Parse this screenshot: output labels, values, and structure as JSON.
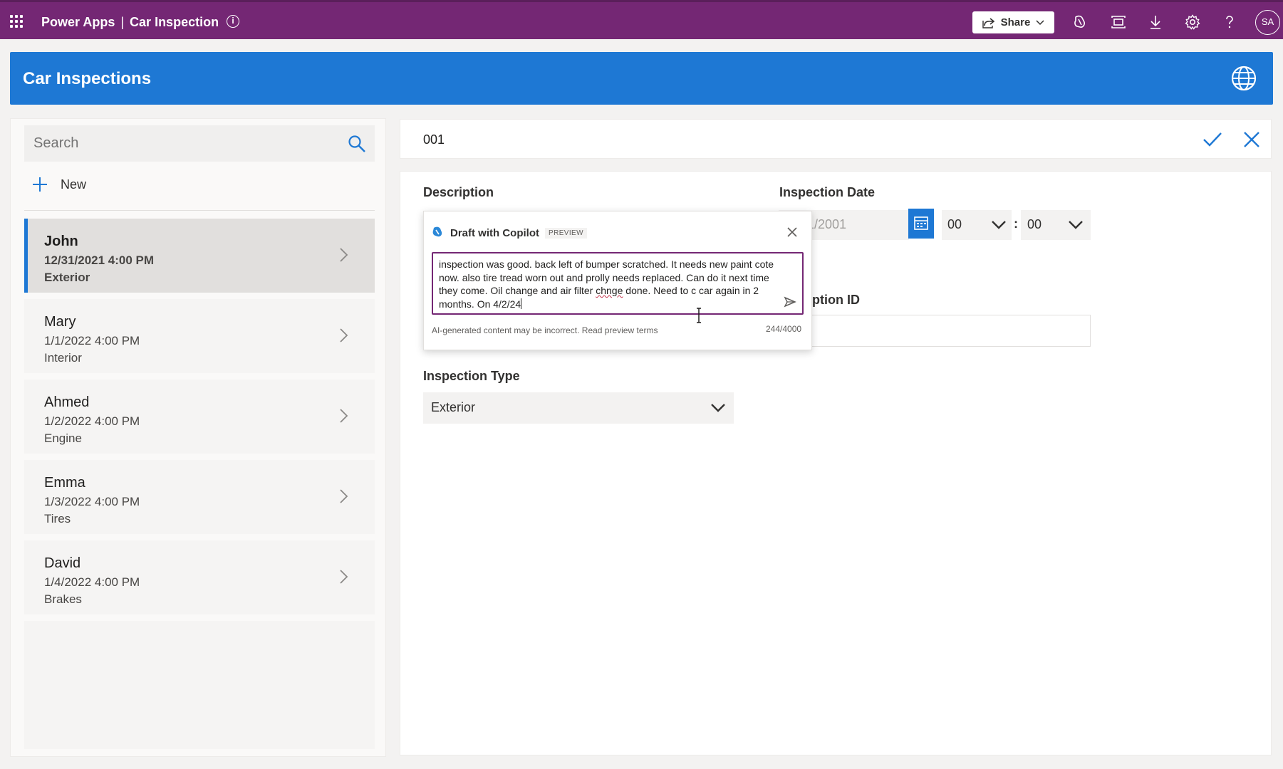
{
  "topbar": {
    "app_name": "Power Apps",
    "separator": "|",
    "document_name": "Car Inspection",
    "share_label": "Share",
    "user_initials": "SA",
    "icons": [
      "waffle-icon",
      "info-icon",
      "copilot-icon",
      "fit-screen-icon",
      "download-icon",
      "settings-icon",
      "help-icon"
    ]
  },
  "app_header": {
    "title": "Car Inspections",
    "globe_icon": "globe-icon"
  },
  "left_panel": {
    "search_placeholder": "Search",
    "new_label": "New",
    "items": [
      {
        "name": "John",
        "date": "12/31/2021 4:00 PM",
        "type": "Exterior",
        "selected": true
      },
      {
        "name": "Mary",
        "date": "1/1/2022 4:00 PM",
        "type": "Interior",
        "selected": false
      },
      {
        "name": "Ahmed",
        "date": "1/2/2022 4:00 PM",
        "type": "Engine",
        "selected": false
      },
      {
        "name": "Emma",
        "date": "1/3/2022 4:00 PM",
        "type": "Tires",
        "selected": false
      },
      {
        "name": "David",
        "date": "1/4/2022 4:00 PM",
        "type": "Brakes",
        "selected": false
      }
    ]
  },
  "record": {
    "id": "001"
  },
  "form": {
    "description_label": "Description",
    "inspection_date_label": "Inspection Date",
    "date_value_partial": "1/2001",
    "hour_value": "00",
    "time_separator": ":",
    "minute_value": "00",
    "description_id_label_partial": "ription ID",
    "inspection_type_label": "Inspection Type",
    "inspection_type_value": "Exterior"
  },
  "copilot": {
    "title": "Draft with Copilot",
    "badge": "PREVIEW",
    "text_part1": "inspection was good. back left of bumper scratched. It needs new paint cote now. also tire tread worn out and prolly needs replaced. Can do it next time they come. Oil change and air filter ",
    "text_typo": "chnge",
    "text_part2": " done. Need to c car again in 2 months. On 4/2/24",
    "disclaimer": "AI-generated content may be incorrect. Read preview terms",
    "char_count": "244/4000"
  },
  "colors": {
    "topbar": "#742774",
    "header": "#1e78d4",
    "accent": "#1e78d4"
  }
}
